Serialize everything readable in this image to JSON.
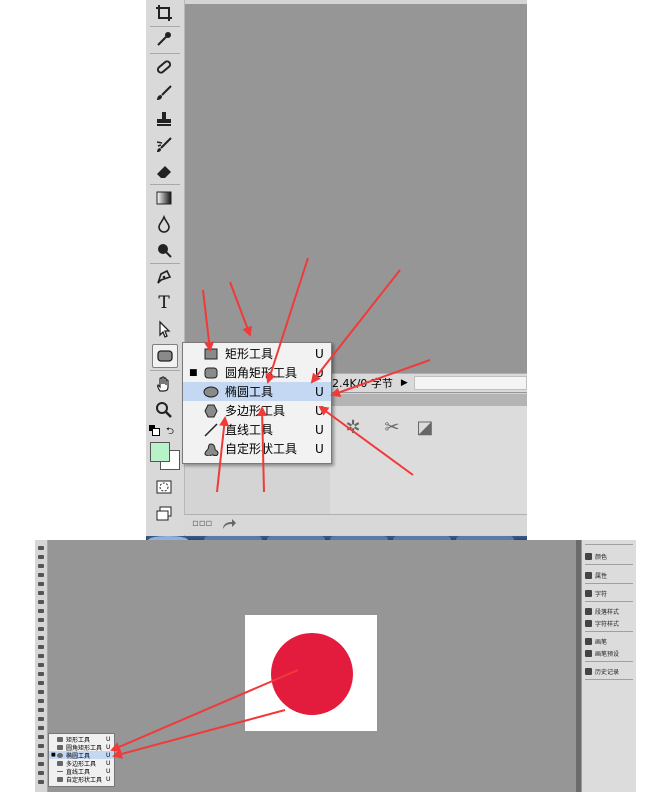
{
  "top_screenshot": {
    "status_text": "2.4K/0 字节",
    "status_arrow": "▶",
    "bottom_bar_glyph": "▫▫▫",
    "bottom_bar_icon": "redo-arrow-icon",
    "panel_buttons": [
      {
        "icon": "gear-icon",
        "glyph": "✲"
      },
      {
        "icon": "scissors-icon",
        "glyph": "✂"
      },
      {
        "icon": "square-icon",
        "glyph": "◪"
      }
    ],
    "tools": [
      {
        "name": "crop-tool",
        "icon": "crop-icon"
      },
      {
        "name": "eyedropper-tool",
        "icon": "eyedropper-icon"
      },
      {
        "name": "healing-brush-tool",
        "icon": "bandage-icon"
      },
      {
        "name": "brush-tool",
        "icon": "brush-icon"
      },
      {
        "name": "clone-stamp-tool",
        "icon": "stamp-icon"
      },
      {
        "name": "history-brush-tool",
        "icon": "history-brush-icon"
      },
      {
        "name": "eraser-tool",
        "icon": "eraser-icon"
      },
      {
        "name": "gradient-tool",
        "icon": "gradient-icon"
      },
      {
        "name": "blur-tool",
        "icon": "drop-icon"
      },
      {
        "name": "dodge-tool",
        "icon": "dodge-icon"
      },
      {
        "name": "pen-tool",
        "icon": "pen-icon"
      },
      {
        "name": "type-tool",
        "icon": "type-icon",
        "glyph": "T"
      },
      {
        "name": "path-select-tool",
        "icon": "arrow-icon"
      },
      {
        "name": "shape-tool",
        "icon": "rounded-rect-icon"
      },
      {
        "name": "hand-tool",
        "icon": "hand-icon"
      },
      {
        "name": "zoom-tool",
        "icon": "zoom-icon"
      }
    ],
    "flyout_menu": [
      {
        "label": "矩形工具",
        "key": "U",
        "icon": "rectangle-icon",
        "current": false,
        "highlighted": false
      },
      {
        "label": "圆角矩形工具",
        "key": "U",
        "icon": "rounded-rectangle-icon",
        "current": true,
        "highlighted": false
      },
      {
        "label": "椭圆工具",
        "key": "U",
        "icon": "ellipse-icon",
        "current": false,
        "highlighted": true
      },
      {
        "label": "多边形工具",
        "key": "U",
        "icon": "polygon-icon",
        "current": false,
        "highlighted": false
      },
      {
        "label": "直线工具",
        "key": "U",
        "icon": "line-icon",
        "current": false,
        "highlighted": false
      },
      {
        "label": "自定形状工具",
        "key": "U",
        "icon": "custom-shape-icon",
        "current": false,
        "highlighted": false
      }
    ],
    "current_bullet": "■"
  },
  "bottom_screenshot": {
    "flyout_menu": [
      {
        "label": "矩形工具",
        "key": "U"
      },
      {
        "label": "圆角矩形工具",
        "key": "U"
      },
      {
        "label": "椭圆工具",
        "key": "U"
      },
      {
        "label": "多边形工具",
        "key": "U"
      },
      {
        "label": "直线工具",
        "key": "U"
      },
      {
        "label": "自定形状工具",
        "key": "U"
      }
    ],
    "right_panel": [
      {
        "label": "颜色",
        "icon": "palette-icon"
      },
      {
        "label": "属性",
        "icon": "properties-icon"
      },
      {
        "label": "字符",
        "icon": "character-icon"
      },
      {
        "label": "段落样式",
        "icon": "paragraph-style-icon"
      },
      {
        "label": "字符样式",
        "icon": "char-style-icon"
      },
      {
        "label": "画笔",
        "icon": "brush-panel-icon"
      },
      {
        "label": "画笔预设",
        "icon": "brush-preset-icon"
      },
      {
        "label": "历史记录",
        "icon": "history-icon"
      }
    ],
    "circle_color": "#e31b3d"
  },
  "colors": {
    "arrow": "#f03a3a",
    "highlight": "#c4d8f4",
    "foreground_swatch": "#b8f2c8",
    "canvas_gray": "#969696"
  }
}
